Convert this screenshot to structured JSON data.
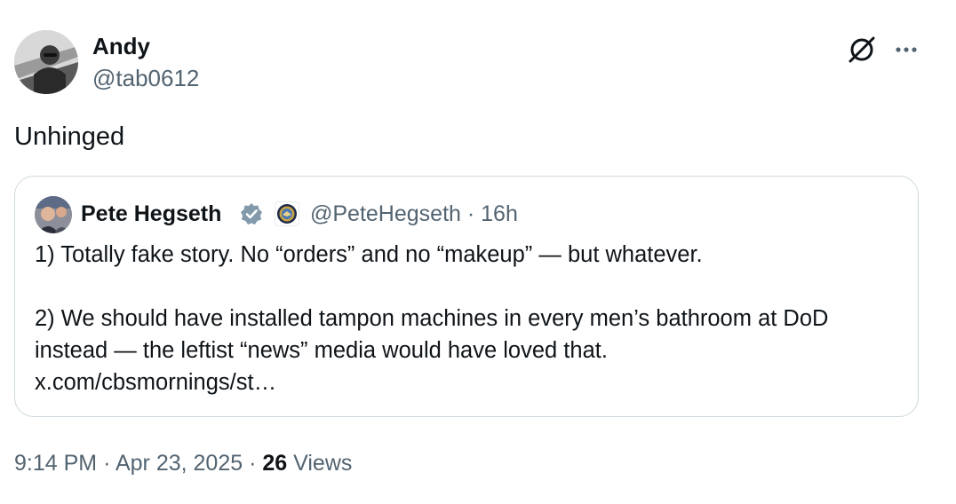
{
  "author": {
    "display_name": "Andy",
    "handle": "@tab0612"
  },
  "tweet": {
    "text": "Unhinged"
  },
  "quoted_tweet": {
    "display_name": "Pete Hegseth",
    "handle": "@PeteHegseth",
    "separator": "·",
    "age": "16h",
    "paragraph_1": "1) Totally fake story. No “orders” and no “makeup” — but whatever.",
    "paragraph_2": "2) We should have installed tampon machines in every men’s bathroom at DoD instead — the leftist “news” media would have loved that.",
    "link": "x.com/cbsmornings/st…"
  },
  "footer": {
    "time": "9:14 PM",
    "dot_1": "·",
    "date": "Apr 23, 2025",
    "dot_2": "·",
    "views_count": "26",
    "views_label": "Views"
  },
  "icons": {
    "grok": "grok-icon",
    "more": "more-horizontal-icon",
    "verified": "verified-badge-icon",
    "affiliate": "dod-seal-icon"
  },
  "colors": {
    "text_primary": "#0f1419",
    "text_secondary": "#536471",
    "border": "#cfd9de",
    "verified_badge": "#829aab"
  }
}
